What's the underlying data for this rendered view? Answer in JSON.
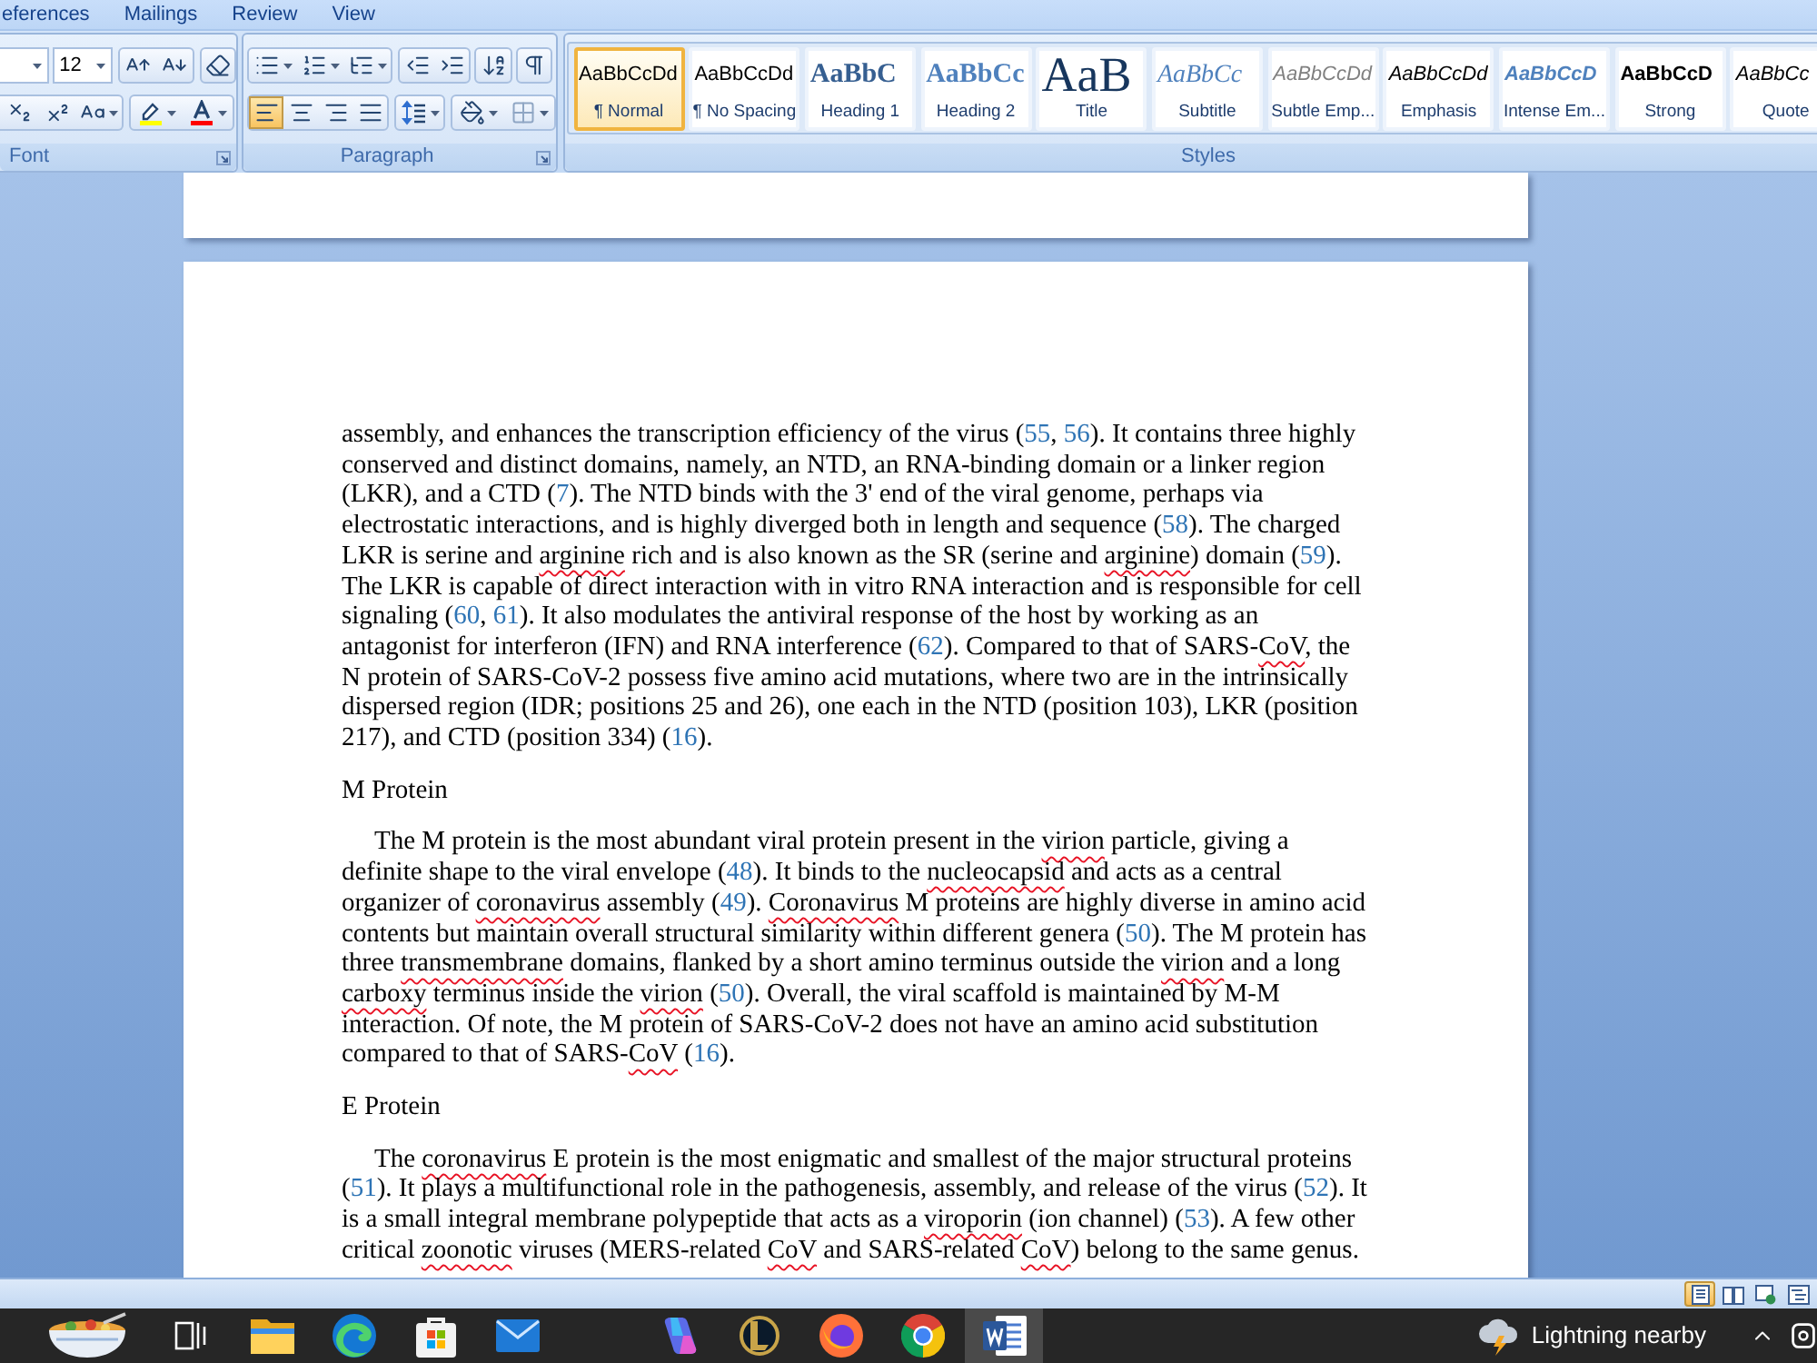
{
  "ribbon": {
    "tabs": [
      {
        "label": "eferences",
        "selected": false
      },
      {
        "label": "Mailings",
        "selected": false
      },
      {
        "label": "Review",
        "selected": false
      },
      {
        "label": "View",
        "selected": false
      }
    ],
    "font": {
      "label": "Font",
      "font_size": "12"
    },
    "paragraph": {
      "label": "Paragraph",
      "align_buttons": [
        {
          "kind": "left",
          "selected": true
        },
        {
          "kind": "center",
          "selected": false
        },
        {
          "kind": "right",
          "selected": false
        },
        {
          "kind": "justify",
          "selected": false
        }
      ]
    },
    "styles": {
      "label": "Styles",
      "items": [
        {
          "kind": "normal",
          "preview": "AaBbCcDd",
          "name": "¶ Normal",
          "selected": true
        },
        {
          "kind": "no_spacing",
          "preview": "AaBbCcDd",
          "name": "¶ No Spacing",
          "selected": false
        },
        {
          "kind": "heading1",
          "preview": "AaBbC",
          "name": "Heading 1",
          "selected": false
        },
        {
          "kind": "heading2",
          "preview": "AaBbCc",
          "name": "Heading 2",
          "selected": false
        },
        {
          "kind": "title",
          "preview": "AaB",
          "name": "Title",
          "selected": false
        },
        {
          "kind": "subtitle",
          "preview": "AaBbCc",
          "name": "Subtitle",
          "selected": false
        },
        {
          "kind": "subtle_emphasis",
          "preview": "AaBbCcDd",
          "name": "Subtle Emp...",
          "selected": false
        },
        {
          "kind": "emphasis",
          "preview": "AaBbCcDd",
          "name": "Emphasis",
          "selected": false
        },
        {
          "kind": "intense_emphasis",
          "preview": "AaBbCcD",
          "name": "Intense Em...",
          "selected": false
        },
        {
          "kind": "strong",
          "preview": "AaBbCcD",
          "name": "Strong",
          "selected": false
        },
        {
          "kind": "quote",
          "preview": "AaBbCc",
          "name": "Quote",
          "selected": false
        }
      ]
    }
  },
  "document": {
    "blocks": [
      {
        "kind": "continued",
        "lines": [
          [
            {
              "kind": "text",
              "text": "assembly, and enhances the transcription efficiency of the virus ("
            },
            {
              "kind": "ref",
              "text": "55"
            },
            {
              "kind": "text",
              "text": ", "
            },
            {
              "kind": "ref",
              "text": "56"
            },
            {
              "kind": "text",
              "text": "). It contains three highly"
            }
          ],
          [
            {
              "kind": "text",
              "text": "conserved and distinct domains, namely, an NTD, an RNA-binding domain or a linker region"
            }
          ],
          [
            {
              "kind": "text",
              "text": "(LKR), and a CTD ("
            },
            {
              "kind": "ref",
              "text": "7"
            },
            {
              "kind": "text",
              "text": "). The NTD binds with the 3' end of the viral genome, perhaps via"
            }
          ],
          [
            {
              "kind": "text",
              "text": "electrostatic interactions, and is highly diverged both in length and sequence ("
            },
            {
              "kind": "ref",
              "text": "58"
            },
            {
              "kind": "text",
              "text": "). The charged"
            }
          ],
          [
            {
              "kind": "text",
              "text": "LKR is serine and "
            },
            {
              "kind": "misspelled",
              "text": "arginine"
            },
            {
              "kind": "text",
              "text": " rich and is also known as the SR (serine and "
            },
            {
              "kind": "misspelled",
              "text": "arginine"
            },
            {
              "kind": "text",
              "text": ") domain ("
            },
            {
              "kind": "ref",
              "text": "59"
            },
            {
              "kind": "text",
              "text": ")."
            }
          ],
          [
            {
              "kind": "text",
              "text": "The LKR is capable of direct interaction with in vitro RNA interaction and is responsible for cell"
            }
          ],
          [
            {
              "kind": "text",
              "text": "signaling ("
            },
            {
              "kind": "ref",
              "text": "60"
            },
            {
              "kind": "text",
              "text": ", "
            },
            {
              "kind": "ref",
              "text": "61"
            },
            {
              "kind": "text",
              "text": "). It also modulates the antiviral response of the host by working as an"
            }
          ],
          [
            {
              "kind": "text",
              "text": "antagonist for interferon (IFN) and RNA interference ("
            },
            {
              "kind": "ref",
              "text": "62"
            },
            {
              "kind": "text",
              "text": "). Compared to that of SARS-"
            },
            {
              "kind": "misspelled",
              "text": "CoV"
            },
            {
              "kind": "text",
              "text": ", the"
            }
          ],
          [
            {
              "kind": "text",
              "text": "N protein of SARS-CoV-2 possess five amino acid mutations, where two are in the intrinsically"
            }
          ],
          [
            {
              "kind": "text",
              "text": "dispersed region (IDR; positions 25 and 26), one each in the NTD (position 103), LKR (position"
            }
          ],
          [
            {
              "kind": "text",
              "text": "217), and CTD (position 334) ("
            },
            {
              "kind": "ref",
              "text": "16"
            },
            {
              "kind": "text",
              "text": ")."
            }
          ]
        ]
      },
      {
        "kind": "heading",
        "text": "M Protein"
      },
      {
        "kind": "paragraph",
        "lines": [
          [
            {
              "kind": "text",
              "text": "The M protein is the most abundant viral protein present in the "
            },
            {
              "kind": "misspelled",
              "text": "virion"
            },
            {
              "kind": "text",
              "text": " particle, giving a"
            }
          ],
          [
            {
              "kind": "text",
              "text": "definite shape to the viral envelope ("
            },
            {
              "kind": "ref",
              "text": "48"
            },
            {
              "kind": "text",
              "text": "). It binds to the "
            },
            {
              "kind": "misspelled",
              "text": "nucleocapsid"
            },
            {
              "kind": "text",
              "text": " and acts as a central"
            }
          ],
          [
            {
              "kind": "text",
              "text": "organizer of "
            },
            {
              "kind": "misspelled",
              "text": "coronavirus"
            },
            {
              "kind": "text",
              "text": " assembly ("
            },
            {
              "kind": "ref",
              "text": "49"
            },
            {
              "kind": "text",
              "text": "). "
            },
            {
              "kind": "misspelled",
              "text": "Coronavirus"
            },
            {
              "kind": "text",
              "text": " M proteins are highly diverse in amino acid"
            }
          ],
          [
            {
              "kind": "text",
              "text": "contents but maintain overall structural similarity within different genera ("
            },
            {
              "kind": "ref",
              "text": "50"
            },
            {
              "kind": "text",
              "text": "). The M protein has"
            }
          ],
          [
            {
              "kind": "text",
              "text": "three "
            },
            {
              "kind": "misspelled",
              "text": "transmembrane"
            },
            {
              "kind": "text",
              "text": " domains, flanked by a short amino terminus outside the "
            },
            {
              "kind": "misspelled",
              "text": "virion"
            },
            {
              "kind": "text",
              "text": " and a long"
            }
          ],
          [
            {
              "kind": "misspelled",
              "text": "carboxy"
            },
            {
              "kind": "text",
              "text": " terminus inside the "
            },
            {
              "kind": "misspelled",
              "text": "virion"
            },
            {
              "kind": "text",
              "text": " ("
            },
            {
              "kind": "ref",
              "text": "50"
            },
            {
              "kind": "text",
              "text": "). Overall, the viral scaffold is maintained by M-M"
            }
          ],
          [
            {
              "kind": "text",
              "text": "interaction. Of note, the M protein of SARS-CoV-2 does not have an amino acid substitution"
            }
          ],
          [
            {
              "kind": "text",
              "text": "compared to that of SARS-"
            },
            {
              "kind": "misspelled",
              "text": "CoV"
            },
            {
              "kind": "text",
              "text": " ("
            },
            {
              "kind": "ref",
              "text": "16"
            },
            {
              "kind": "text",
              "text": ")."
            }
          ]
        ]
      },
      {
        "kind": "heading",
        "text": "E Protein"
      },
      {
        "kind": "paragraph",
        "lines": [
          [
            {
              "kind": "text",
              "text": "The "
            },
            {
              "kind": "misspelled",
              "text": "coronavirus"
            },
            {
              "kind": "text",
              "text": " E protein is the most enigmatic and smallest of the major structural proteins"
            }
          ],
          [
            {
              "kind": "text",
              "text": "("
            },
            {
              "kind": "ref",
              "text": "51"
            },
            {
              "kind": "text",
              "text": "). It plays a multifunctional role in the pathogenesis, assembly, and release of the virus ("
            },
            {
              "kind": "ref",
              "text": "52"
            },
            {
              "kind": "text",
              "text": "). It"
            }
          ],
          [
            {
              "kind": "text",
              "text": "is a small integral membrane polypeptide that acts as a "
            },
            {
              "kind": "misspelled",
              "text": "viroporin"
            },
            {
              "kind": "text",
              "text": " (ion channel) ("
            },
            {
              "kind": "ref",
              "text": "53"
            },
            {
              "kind": "text",
              "text": "). A few other"
            }
          ],
          [
            {
              "kind": "text",
              "text": "critical "
            },
            {
              "kind": "misspelled",
              "text": "zoonotic"
            },
            {
              "kind": "text",
              "text": " viruses (MERS-related "
            },
            {
              "kind": "misspelled",
              "text": "CoV"
            },
            {
              "kind": "text",
              "text": " and SARS-related "
            },
            {
              "kind": "misspelled",
              "text": "CoV"
            },
            {
              "kind": "text",
              "text": ") belong to the same genus."
            }
          ]
        ]
      }
    ]
  },
  "status_bar": {
    "views": [
      {
        "kind": "print",
        "selected": true
      },
      {
        "kind": "reading",
        "selected": false
      },
      {
        "kind": "web",
        "selected": false
      },
      {
        "kind": "outline",
        "selected": false
      }
    ]
  },
  "taskbar": {
    "app_groups": [
      [
        {
          "kind": "task_view",
          "selected": false
        },
        {
          "kind": "folder",
          "selected": false
        },
        {
          "kind": "swirl",
          "selected": false
        },
        {
          "kind": "bag",
          "selected": false
        },
        {
          "kind": "envelope",
          "selected": false
        }
      ],
      [
        {
          "kind": "prism",
          "selected": false
        },
        {
          "kind": "emblem",
          "selected": false
        },
        {
          "kind": "fox",
          "selected": false
        },
        {
          "kind": "ring",
          "selected": false
        },
        {
          "kind": "document",
          "selected": true
        }
      ]
    ],
    "weather": "Lightning nearby"
  }
}
